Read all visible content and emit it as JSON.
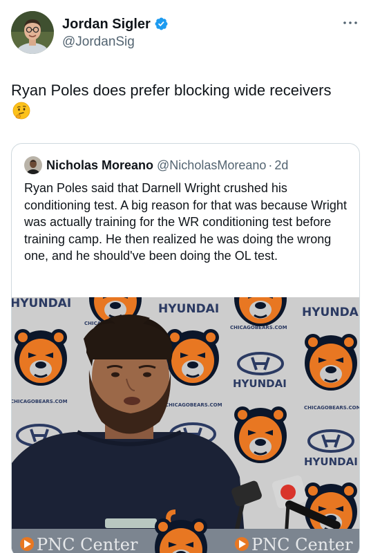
{
  "tweet": {
    "author": {
      "display_name": "Jordan Sigler",
      "handle": "@JordanSig",
      "verified": true,
      "verified_color": "#1d9bf0"
    },
    "text": "Ryan Poles does prefer blocking wide receivers",
    "emoji": "thinking-face",
    "more_icon": "ellipsis-icon"
  },
  "quoted_tweet": {
    "author": {
      "display_name": "Nicholas Moreano",
      "handle": "@NicholasMoreano",
      "separator": "·",
      "time": "2d"
    },
    "text": "Ryan Poles said that Darnell Wright crushed his conditioning test. A big reason for that was because Wright was actually training for the WR conditioning test before training camp. He then realized he was doing the wrong one, and he should've been doing the OL test.",
    "media": {
      "backdrop_brand_1": "HYUNDAI",
      "backdrop_url": "CHICAGOBEARS.COM",
      "podium_banner": "PNC Center",
      "bears_orange": "#e87722",
      "bears_navy": "#0b162a"
    }
  }
}
